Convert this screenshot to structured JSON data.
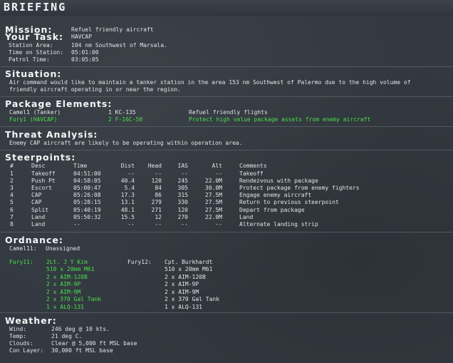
{
  "title": "BRIEFING",
  "mission": {
    "label": "Mission:",
    "value": "Refuel friendly aircraft",
    "task_label": "Your Task:",
    "task_value": "HAVCAP",
    "fields": [
      {
        "label": "Station Area:",
        "value": "104 nm Southwest of Marsala."
      },
      {
        "label": "Time on Station:",
        "value": "05:01:00"
      },
      {
        "label": "Patrol Time:",
        "value": "03:05:05"
      }
    ]
  },
  "situation": {
    "heading": "Situation:",
    "line1": "Air command would like to maintain a tanker station in the area 153 nm Southwest of Palermo due to the high volume of",
    "line2": "friendly aircraft operating in or near the region."
  },
  "package": {
    "heading": "Package Elements:",
    "rows": [
      {
        "name": "Camel1 (Tanker)",
        "aircraft": "1 KC-135",
        "task": "Refuel friendly flights",
        "highlight": false
      },
      {
        "name": "Fury1 (HAVCAP)",
        "aircraft": "2 F-16C-50",
        "task": "Protect high value package assets from enemy aircraft",
        "highlight": true
      }
    ]
  },
  "threat": {
    "heading": "Threat Analysis:",
    "text": "Enemy CAP aircraft are likely to be operating within operation area."
  },
  "steerpoints": {
    "heading": "Steerpoints:",
    "columns": [
      "#",
      "Desc",
      "Time",
      "Dist",
      "Head",
      "IAS",
      "Alt",
      "Comments"
    ],
    "rows": [
      [
        "1",
        "Takeoff",
        "04:51:00",
        "--",
        "--",
        "--",
        "--",
        "Takeoff"
      ],
      [
        "2",
        "Push Pt",
        "04:58:05",
        "40.4",
        "120",
        "245",
        "22.0M",
        "Rendezvous with package"
      ],
      [
        "3",
        "Escort",
        "05:00:47",
        "5.4",
        "84",
        "305",
        "30.0M",
        "Protect package from enemy fighters"
      ],
      [
        "4",
        "CAP",
        "05:26:08",
        "17.3",
        "86",
        "315",
        "27.5M",
        "Engage enemy aircraft"
      ],
      [
        "5",
        "CAP",
        "05:28:15",
        "13.1",
        "279",
        "330",
        "27.5M",
        "Return to previous steerpoint"
      ],
      [
        "6",
        "Split",
        "05:40:19",
        "48.1",
        "271",
        "120",
        "27.5M",
        "Depart from package"
      ],
      [
        "7",
        "Land",
        "05:50:32",
        "15.5",
        "12",
        "270",
        "22.0M",
        "Land"
      ],
      [
        "8",
        "Land",
        "--",
        "--",
        "--",
        "--",
        "--",
        "Alternate landing strip"
      ]
    ]
  },
  "ordnance": {
    "heading": "Ordnance:",
    "camel_label": "Camel11:",
    "camel_value": "Unassigned",
    "fury11": {
      "label": "Fury11:",
      "pilot": "2Lt. J Y Kim",
      "items": [
        "510 x 20mm M61",
        "2 x AIM-120B",
        "2 x AIM-9P",
        "2 x AIM-9M",
        "2 x 370 Gal Tank",
        "1 x ALQ-131"
      ]
    },
    "fury12": {
      "label": "Fury12:",
      "pilot": "Cpt. Burkhardt",
      "items": [
        "510 x 20mm M61",
        "2 x AIM-120B",
        "2 x AIM-9P",
        "2 x AIM-9M",
        "2 x 370 Gal Tank",
        "1 x ALQ-131"
      ]
    }
  },
  "weather": {
    "heading": "Weather:",
    "fields": [
      {
        "label": "Wind:",
        "value": "246 deg @ 10 kts."
      },
      {
        "label": "Temp:",
        "value": "21 deg C."
      },
      {
        "label": "Clouds:",
        "value": "Clear @ 5,000 ft MSL base"
      },
      {
        "label": "Con Layer:",
        "value": "30,000 ft MSL base"
      }
    ]
  }
}
